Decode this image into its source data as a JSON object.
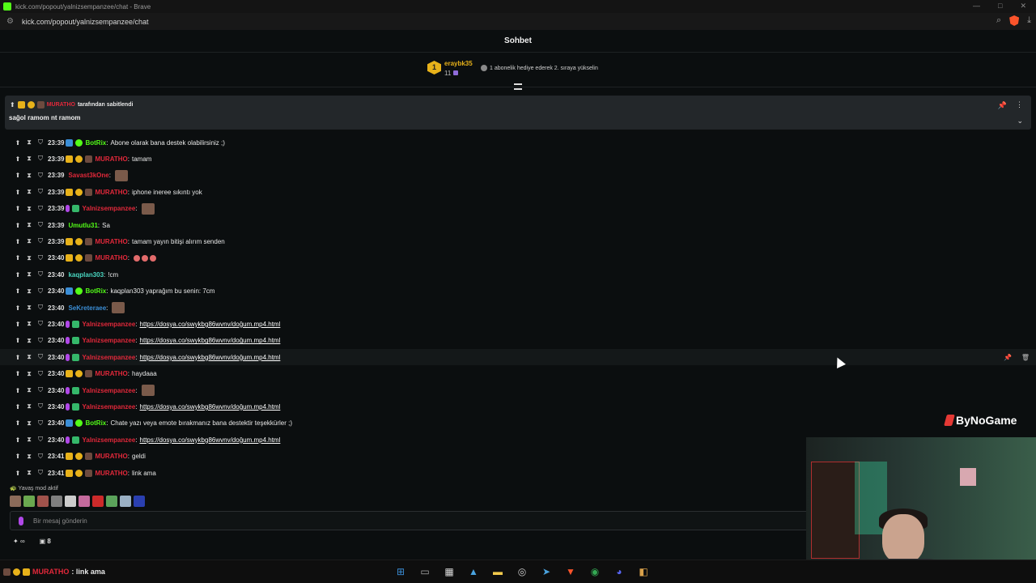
{
  "browser": {
    "title": "kick.com/popout/yalnizsempanzee/chat - Brave",
    "url": "kick.com/popout/yalnizsempanzee/chat"
  },
  "header": {
    "title": "Sohbet"
  },
  "subscriber_bar": {
    "badge": "1",
    "username": "eraybk35",
    "count": "11",
    "info": "1 abonelik hediye ederek 2. sıraya yükselin"
  },
  "pinned": {
    "author": "MURATHO",
    "by_text": "tarafından sabitlendi",
    "message": "sağol ramom nt ramom"
  },
  "colors": {
    "accent": "#53fc18",
    "red_user": "#e2283a",
    "green_user": "#53fc18",
    "blue_user": "#3b8ed6",
    "teal_user": "#49d6c0"
  },
  "messages": [
    {
      "time": "23:39",
      "badges": [
        "bot",
        "verif"
      ],
      "user": "BotRix",
      "user_color": "#53fc18",
      "text": "Abone olarak bana destek olabilirsiniz ;)"
    },
    {
      "time": "23:39",
      "badges": [
        "crown",
        "coin",
        "avatar"
      ],
      "user": "MURATHO",
      "user_color": "#e2283a",
      "text": "tamam"
    },
    {
      "time": "23:39",
      "badges": [],
      "user": "Savast3kOne",
      "user_color": "#e2283a",
      "text": "",
      "emote": true
    },
    {
      "time": "23:39",
      "badges": [
        "crown",
        "coin",
        "avatar"
      ],
      "user": "MURATHO",
      "user_color": "#e2283a",
      "text": "iphone ineree sıkıntı yok"
    },
    {
      "time": "23:39",
      "badges": [
        "mic",
        "mod"
      ],
      "user": "Yalnizsempanzee",
      "user_color": "#e2283a",
      "text": "",
      "emote": true
    },
    {
      "time": "23:39",
      "badges": [],
      "user": "Umutlu31",
      "user_color": "#53fc18",
      "text": "Sa"
    },
    {
      "time": "23:39",
      "badges": [
        "crown",
        "coin",
        "avatar"
      ],
      "user": "MURATHO",
      "user_color": "#e2283a",
      "text": "tamam yayın bitişi alırım senden"
    },
    {
      "time": "23:40",
      "badges": [
        "crown",
        "coin",
        "avatar"
      ],
      "user": "MURATHO",
      "user_color": "#e2283a",
      "text": "",
      "minis": 3
    },
    {
      "time": "23:40",
      "badges": [],
      "user": "kaqplan303",
      "user_color": "#49d6c0",
      "text": "!cm"
    },
    {
      "time": "23:40",
      "badges": [
        "bot",
        "verif"
      ],
      "user": "BotRix",
      "user_color": "#53fc18",
      "text": "kaqplan303 yaprağım bu senin: 7cm"
    },
    {
      "time": "23:40",
      "badges": [],
      "user": "SeKreteraee",
      "user_color": "#3b8ed6",
      "text": "",
      "emote": true
    },
    {
      "time": "23:40",
      "badges": [
        "mic",
        "mod"
      ],
      "user": "Yalnizsempanzee",
      "user_color": "#e2283a",
      "link": "https://dosya.co/swykbg86wvnv/doğum.mp4.html"
    },
    {
      "time": "23:40",
      "badges": [
        "mic",
        "mod"
      ],
      "user": "Yalnizsempanzee",
      "user_color": "#e2283a",
      "link": "https://dosya.co/swykbg86wvnv/doğum.mp4.html"
    },
    {
      "time": "23:40",
      "badges": [
        "mic",
        "mod"
      ],
      "user": "Yalnizsempanzee",
      "user_color": "#e2283a",
      "link": "https://dosya.co/swykbg86wvnv/doğum.mp4.html",
      "hover": true
    },
    {
      "time": "23:40",
      "badges": [
        "crown",
        "coin",
        "avatar"
      ],
      "user": "MURATHO",
      "user_color": "#e2283a",
      "text": "haydaaa"
    },
    {
      "time": "23:40",
      "badges": [
        "mic",
        "mod"
      ],
      "user": "Yalnizsempanzee",
      "user_color": "#e2283a",
      "text": "",
      "emote": true
    },
    {
      "time": "23:40",
      "badges": [
        "mic",
        "mod"
      ],
      "user": "Yalnizsempanzee",
      "user_color": "#e2283a",
      "link": "https://dosya.co/swykbg86wvnv/doğum.mp4.html"
    },
    {
      "time": "23:40",
      "badges": [
        "bot",
        "verif"
      ],
      "user": "BotRix",
      "user_color": "#53fc18",
      "text": "Chate yazı veya emote bırakmanız bana destektir teşekkürler ;)"
    },
    {
      "time": "23:40",
      "badges": [
        "mic",
        "mod"
      ],
      "user": "Yalnizsempanzee",
      "user_color": "#e2283a",
      "link": "https://dosya.co/swykbg86wvnv/doğum.mp4.html"
    },
    {
      "time": "23:41",
      "badges": [
        "crown",
        "coin",
        "avatar"
      ],
      "user": "MURATHO",
      "user_color": "#e2283a",
      "text": "geldi"
    },
    {
      "time": "23:41",
      "badges": [
        "crown",
        "coin",
        "avatar"
      ],
      "user": "MURATHO",
      "user_color": "#e2283a",
      "text": "link ama"
    }
  ],
  "slow_mode": "Yavaş mod aktif",
  "input": {
    "placeholder": "Bir mesaj gönderin"
  },
  "footer": {
    "viewers_icon": "∞",
    "count": "8"
  },
  "taskbar_last": {
    "user": "MURATHO",
    "text": ": link ama"
  },
  "brand": "ByNoGame"
}
